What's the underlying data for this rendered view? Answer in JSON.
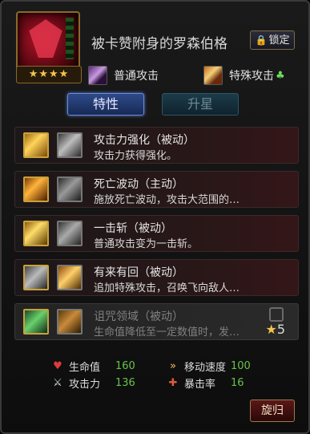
{
  "hero": {
    "name": "被卡赞附身的罗森伯格",
    "stars": "★★★★"
  },
  "lock_button": {
    "label": "锁定"
  },
  "attacks": {
    "normal": {
      "label": "普通攻击"
    },
    "special": {
      "label": "特殊攻击"
    }
  },
  "tabs": [
    {
      "label": "特性",
      "active": true
    },
    {
      "label": "升星",
      "active": false
    }
  ],
  "traits": [
    {
      "title": "攻击力强化（被动）",
      "desc": "攻击力获得强化。",
      "locked": false
    },
    {
      "title": "死亡波动（主动）",
      "desc": "施放死亡波动，攻击大范围的…",
      "locked": false
    },
    {
      "title": "一击斩（被动）",
      "desc": "普通攻击变为一击斩。",
      "locked": false
    },
    {
      "title": "有来有回（被动）",
      "desc": "追加特殊攻击，召唤飞向敌人…",
      "locked": false
    },
    {
      "title": "诅咒领域（被动）",
      "desc": "生命值降低至一定数值时，发…",
      "locked": true,
      "req_stars": "5"
    }
  ],
  "stats": {
    "hp": {
      "label": "生命值",
      "value": "160"
    },
    "attack": {
      "label": "攻击力",
      "value": "136"
    },
    "move_speed": {
      "label": "移动速度",
      "value": "100"
    },
    "crit": {
      "label": "暴击率",
      "value": "16"
    }
  },
  "back_button": {
    "label": "旋归"
  },
  "colors": {
    "stat_value": "#67c34a",
    "star": "#f5c54a",
    "tab_active": "#2e4a8a"
  }
}
